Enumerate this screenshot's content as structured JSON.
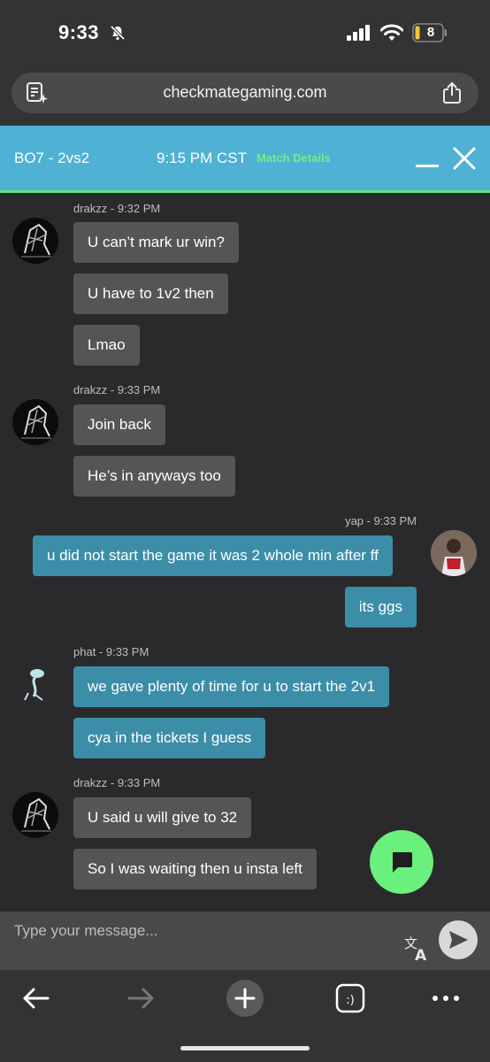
{
  "status_bar": {
    "time": "9:33",
    "battery": "8"
  },
  "browser": {
    "url": "checkmategaming.com"
  },
  "match": {
    "type": "BO7 - 2vs2",
    "time": "9:15 PM CST",
    "details_link": "Match Details"
  },
  "messages": [
    {
      "meta": "drakzz - 9:32 PM",
      "side": "left",
      "texts": [
        "U can’t mark ur win?",
        "U have to 1v2 then",
        "Lmao"
      ]
    },
    {
      "meta": "drakzz - 9:33 PM",
      "side": "left",
      "texts": [
        "Join back",
        "He’s in anyways too"
      ]
    },
    {
      "meta": "yap - 9:33 PM",
      "side": "right",
      "texts": [
        "u did not start the game it was 2 whole min after ff",
        "its ggs"
      ]
    },
    {
      "meta": "phat - 9:33 PM",
      "side": "left",
      "texts": [
        "we gave plenty of time for u to start the 2v1",
        "cya in the tickets I guess"
      ]
    },
    {
      "meta": "drakzz - 9:33 PM",
      "side": "left",
      "texts": [
        "U said u will give to 32",
        "So I was waiting then u insta left"
      ]
    }
  ],
  "composer": {
    "placeholder": "Type your message..."
  },
  "colors": {
    "header": "#4fb1d3",
    "own_bubble": "#3c8ea8",
    "other_bubble": "#555558",
    "fab": "#6af07d",
    "link": "#6ff08a"
  },
  "icons": {
    "reader": "reader-mode-icon",
    "share": "share-icon",
    "translate": "translate-icon",
    "send": "send-icon",
    "chat": "chat-bubble-icon"
  }
}
